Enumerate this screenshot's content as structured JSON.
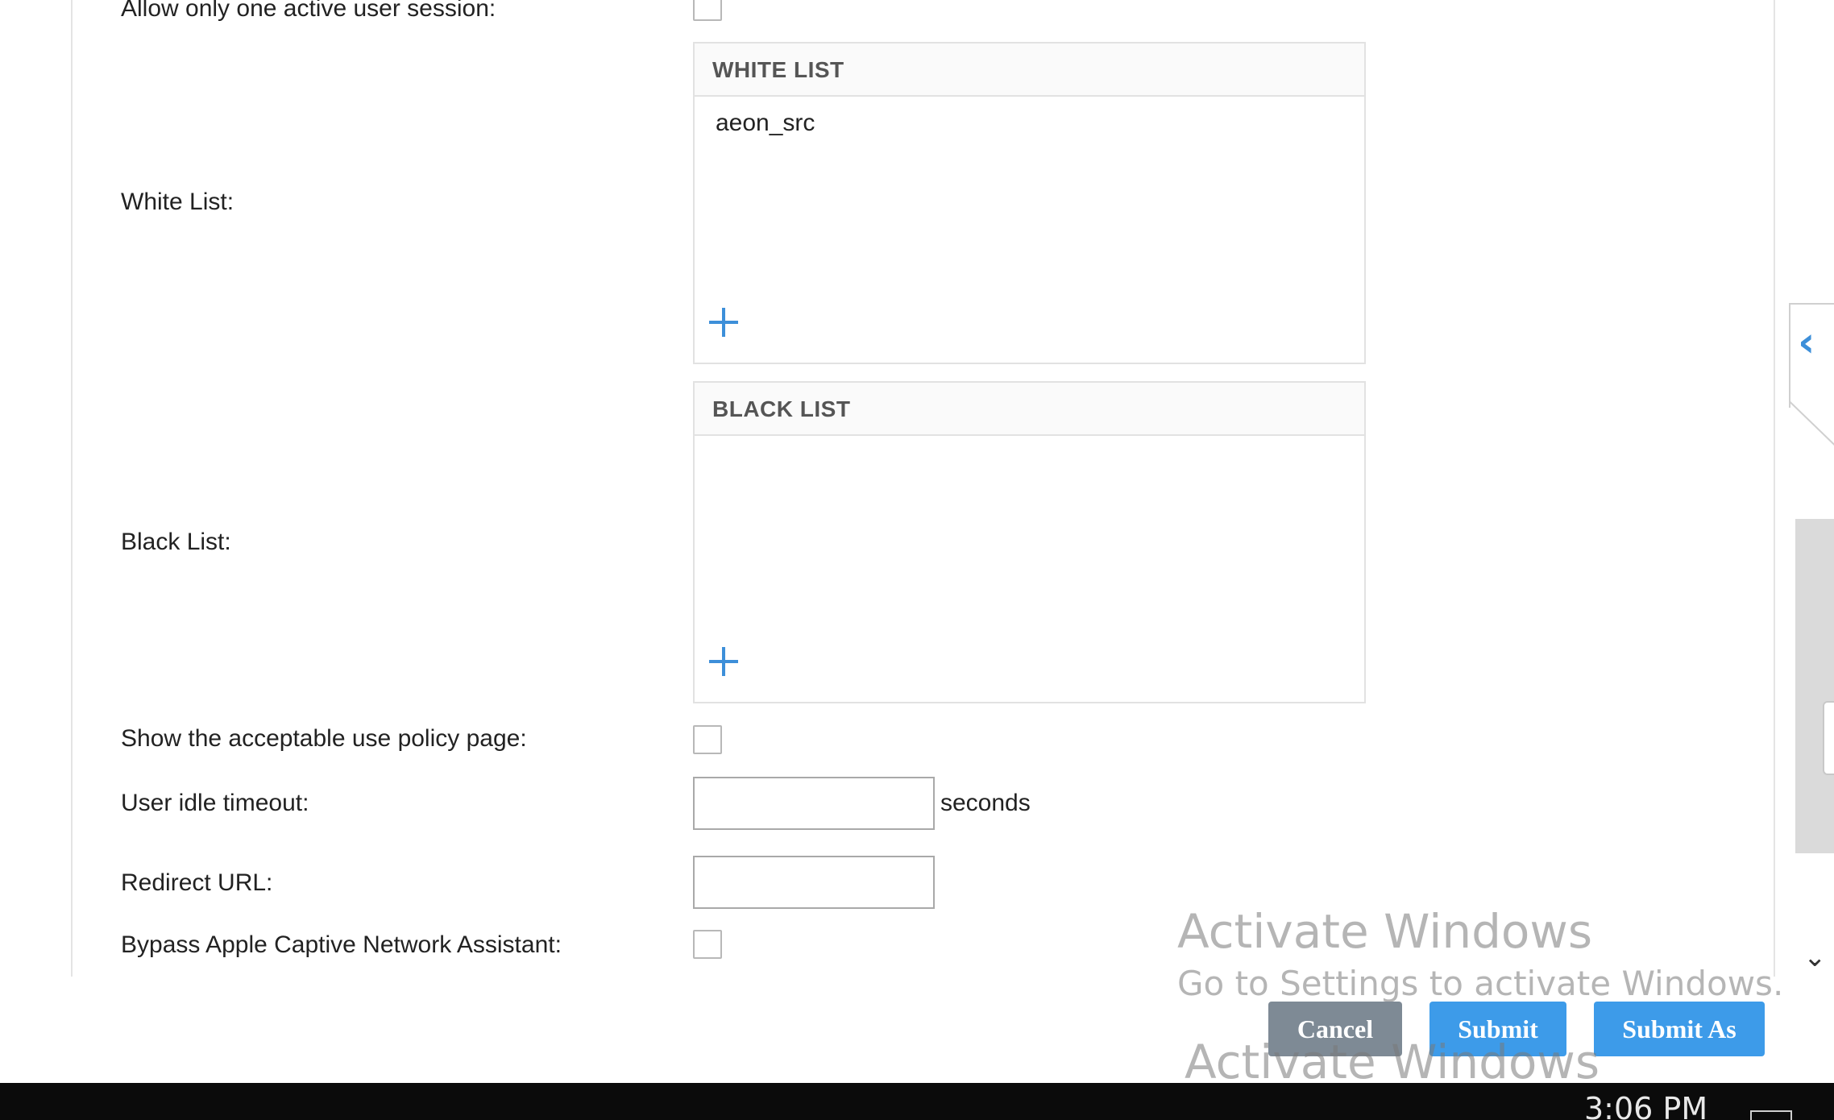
{
  "form": {
    "single_session": {
      "label": "Allow only one active user session:",
      "checked": false
    },
    "white_list": {
      "label": "White List:",
      "header": "WHITE LIST",
      "items": [
        "aeon_src"
      ]
    },
    "black_list": {
      "label": "Black List:",
      "header": "BLACK LIST",
      "items": []
    },
    "aup": {
      "label": "Show the acceptable use policy page:",
      "checked": false
    },
    "idle_timeout": {
      "label": "User idle timeout:",
      "value": "",
      "unit": "seconds"
    },
    "redirect_url": {
      "label": "Redirect URL:",
      "value": ""
    },
    "bypass_cna": {
      "label": "Bypass Apple Captive Network Assistant:",
      "checked": false
    }
  },
  "actions": {
    "cancel": "Cancel",
    "submit": "Submit",
    "submit_as": "Submit As"
  },
  "watermark": {
    "title": "Activate Windows",
    "subtitle": "Go to Settings to activate Windows."
  },
  "taskbar": {
    "clock": "3:06 PM"
  },
  "colors": {
    "accent": "#3d9be9",
    "cancel": "#7e8a95",
    "taskbar": "#0b0b0b"
  },
  "icons": {
    "add": "plus-icon",
    "collapse": "chevron-left-icon",
    "scroll_down": "chevron-down-icon"
  }
}
